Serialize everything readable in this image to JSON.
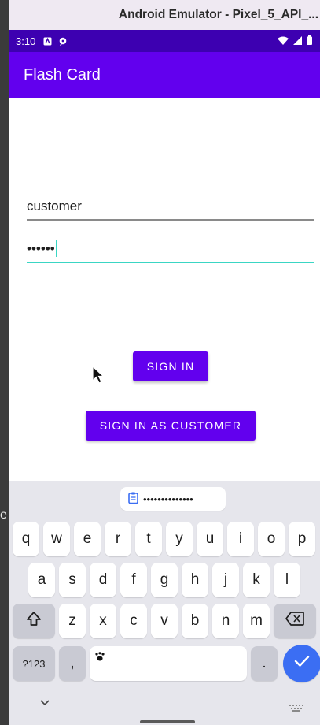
{
  "host": {
    "side_label": "e"
  },
  "window": {
    "title": "Android Emulator - Pixel_5_API_..."
  },
  "statusbar": {
    "time": "3:10"
  },
  "appbar": {
    "title": "Flash Card"
  },
  "form": {
    "username_value": "customer",
    "password_value": "••••••"
  },
  "buttons": {
    "sign_in": "SIGN IN",
    "sign_in_customer": "SIGN IN AS CUSTOMER"
  },
  "keyboard": {
    "suggestion": "••••••••••••••",
    "row1": [
      "q",
      "w",
      "e",
      "r",
      "t",
      "y",
      "u",
      "i",
      "o",
      "p"
    ],
    "row2": [
      "a",
      "s",
      "d",
      "f",
      "g",
      "h",
      "j",
      "k",
      "l"
    ],
    "row3": [
      "z",
      "x",
      "c",
      "v",
      "b",
      "n",
      "m"
    ],
    "symbols_label": "?123",
    "comma_label": ",",
    "period_label": ".",
    "shift_icon": "shift-icon",
    "backspace_icon": "backspace-icon",
    "enter_icon": "check-icon",
    "emoji_icon": "paw-icon"
  },
  "colors": {
    "status_bar": "#3d00b1",
    "app_bar": "#6200ee",
    "button": "#6200ee",
    "focus_underline": "#3ad6c4",
    "enter_key": "#3b6ef3"
  }
}
